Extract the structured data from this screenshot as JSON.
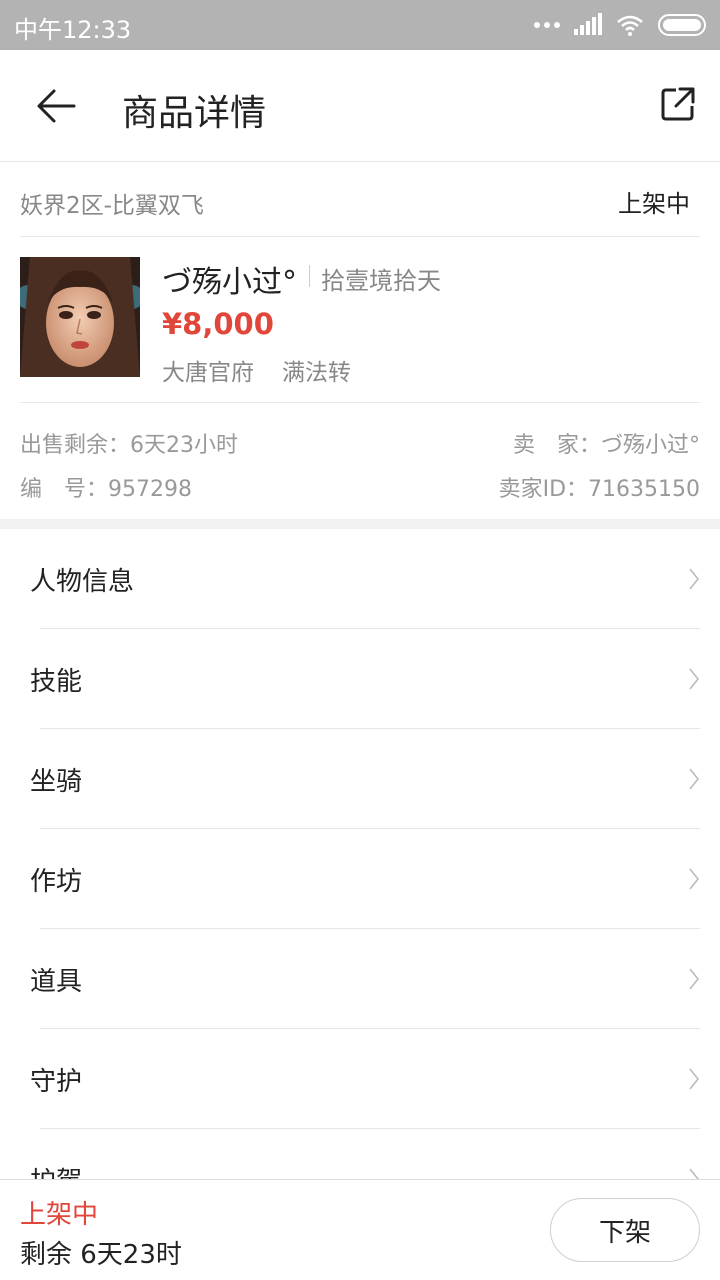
{
  "status_bar": {
    "time": "中午12:33"
  },
  "header": {
    "title": "商品详情",
    "back_icon": "back-arrow-icon",
    "share_icon": "share-icon"
  },
  "summary": {
    "server": "妖界2区-比翼双飞",
    "status": "上架中",
    "character_name": "づ殇小过°",
    "level": "拾壹境拾天",
    "price": "¥8,000",
    "school": "大唐官府",
    "transfer": "满法转",
    "sale_remaining": "出售剩余：6天23小时",
    "serial_number": "编　号：957298",
    "seller": "卖　家：づ殇小过°",
    "seller_id": "卖家ID：71635150"
  },
  "menu": {
    "items": [
      {
        "label": "人物信息"
      },
      {
        "label": "技能"
      },
      {
        "label": "坐骑"
      },
      {
        "label": "作坊"
      },
      {
        "label": "道具"
      },
      {
        "label": "守护"
      },
      {
        "label": "护駕"
      }
    ]
  },
  "bottom": {
    "state": "上架中",
    "remaining": "剩余 6天23时",
    "button_label": "下架"
  },
  "colors": {
    "accent_red": "#e0463a",
    "status_bar_bg": "#b3b3b3"
  }
}
